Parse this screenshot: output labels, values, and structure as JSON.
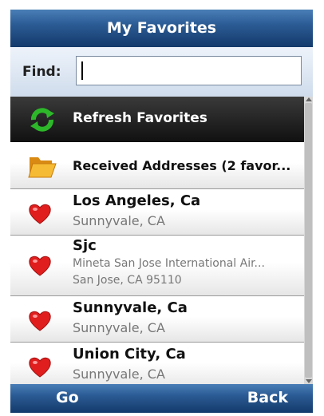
{
  "title": "My Favorites",
  "find": {
    "label": "Find:",
    "value": ""
  },
  "menu": {
    "refresh_label": "Refresh Favorites",
    "received_label": "Received Addresses (2 favor..."
  },
  "favorites": [
    {
      "name": "Los Angeles, Ca",
      "detail": "Sunnyvale, CA"
    },
    {
      "name": "Sjc",
      "detail": "Mineta San Jose International Air...",
      "address": "San Jose, CA 95110"
    },
    {
      "name": "Sunnyvale, Ca",
      "detail": "Sunnyvale, CA"
    },
    {
      "name": "Union City, Ca",
      "detail": "Sunnyvale, CA"
    }
  ],
  "softkeys": {
    "left": "Go",
    "right": "Back"
  },
  "icons": {
    "refresh": "refresh-icon",
    "folder": "folder-icon",
    "favorite": "heart-icon"
  }
}
